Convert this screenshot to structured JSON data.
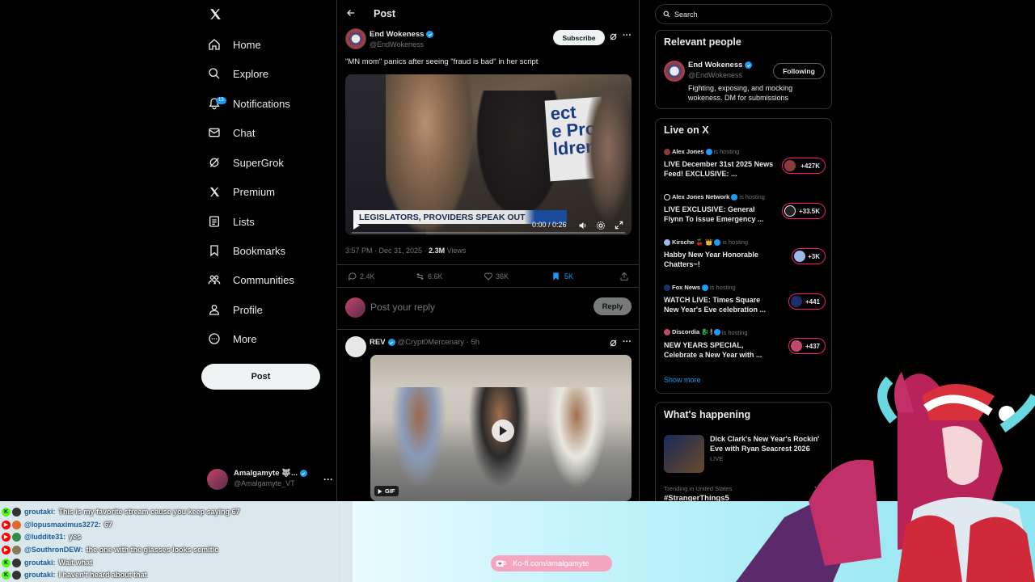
{
  "nav": {
    "items": [
      {
        "label": "Home",
        "icon": "home-icon"
      },
      {
        "label": "Explore",
        "icon": "search-icon"
      },
      {
        "label": "Notifications",
        "icon": "bell-icon",
        "badge": "13"
      },
      {
        "label": "Chat",
        "icon": "mail-icon"
      },
      {
        "label": "SuperGrok",
        "icon": "grok-icon"
      },
      {
        "label": "Premium",
        "icon": "x-logo-icon"
      },
      {
        "label": "Lists",
        "icon": "list-icon"
      },
      {
        "label": "Bookmarks",
        "icon": "bookmark-icon"
      },
      {
        "label": "Communities",
        "icon": "people-icon"
      },
      {
        "label": "Profile",
        "icon": "person-icon"
      },
      {
        "label": "More",
        "icon": "more-circle-icon"
      }
    ],
    "post_label": "Post",
    "account": {
      "name": "Amalgamyte 🐺...",
      "handle": "@Amalgamyte_VT"
    }
  },
  "header": {
    "title": "Post"
  },
  "tweet": {
    "author": "End Wokeness",
    "handle": "@EndWokeness",
    "subscribe_label": "Subscribe",
    "text": "\"MN mom\" panics after seeing \"fraud is bad\" in her script",
    "video": {
      "banner": "LEGISLATORS, PROVIDERS SPEAK OUT",
      "time": "0:00 / 0:26",
      "sign_text": "ect\ne Pro\nldren"
    },
    "meta_time": "3:57 PM · Dec 31, 2025 · ",
    "views": "2.3M",
    "views_label": " Views",
    "stats": {
      "replies": "2.4K",
      "reposts": "6.6K",
      "likes": "36K",
      "bookmarks": "5K"
    },
    "reply_placeholder": "Post your reply",
    "reply_button": "Reply"
  },
  "reply_tweet": {
    "author": "REV",
    "handle": "@Crypt0Mercenary · 5h",
    "gif_label": "GIF"
  },
  "search": {
    "placeholder": "Search"
  },
  "relevant": {
    "title": "Relevant people",
    "name": "End Wokeness",
    "handle": "@EndWokeness",
    "button": "Following",
    "bio": "Fighting, exposing, and mocking wokeness. DM for submissions"
  },
  "live": {
    "title": "Live on X",
    "host_suffix": "is hosting",
    "items": [
      {
        "host": "Alex Jones",
        "title": "LIVE December 31st 2025 News Feed! EXCLUSIVE: ...",
        "count": "+427K",
        "avatar_color": "#8a3a3a"
      },
      {
        "host": "Alex Jones Network",
        "title": "LIVE EXCLUSIVE: General Flynn To issue Emergency ...",
        "count": "+33.5K",
        "avatar_color": "#222222"
      },
      {
        "host": "Kirsche 🍒 👑",
        "title": "Habby New Year Honorable Chatters~!",
        "count": "+3K",
        "avatar_color": "#9ab8e8"
      },
      {
        "host": "Fox News",
        "title": "WATCH LIVE: Times Square New Year's Eve celebration ...",
        "count": "+441",
        "avatar_color": "#1d2f6a"
      },
      {
        "host": "Discordia 🐉 🕯",
        "title": "NEW YEARS SPECIAL, Celebrate a New Year with ...",
        "count": "+437",
        "avatar_color": "#c04a6a"
      }
    ],
    "show_more": "Show more"
  },
  "happening": {
    "title": "What's happening",
    "event_title": "Dick Clark's New Year's Rockin' Eve with Ryan Seacrest 2026",
    "event_status": "LIVE",
    "trend_context": "Trending in United States",
    "trend_name": "#StrangerThings5"
  },
  "chat": [
    {
      "user": "groutaki:",
      "msg": "This is my favorite stream cause you keep saying 67",
      "platform": "kick"
    },
    {
      "user": "@lopusmaximus3272:",
      "msg": "67",
      "platform": "youtube"
    },
    {
      "user": "@luddite31:",
      "msg": "yes",
      "platform": "youtube"
    },
    {
      "user": "@SouthronDEW:",
      "msg": "the one with the glasses looks semitic",
      "platform": "youtube"
    },
    {
      "user": "groutaki:",
      "msg": "Wait what",
      "platform": "kick"
    },
    {
      "user": "groutaki:",
      "msg": "I haven't heard about that",
      "platform": "kick"
    }
  ],
  "kofi": {
    "label": "Ko-fi.com/amalgamyte"
  },
  "colors": {
    "accent": "#1d9bf0",
    "live": "#f91880",
    "kick": "#53fc18",
    "youtube": "#ff0000"
  }
}
